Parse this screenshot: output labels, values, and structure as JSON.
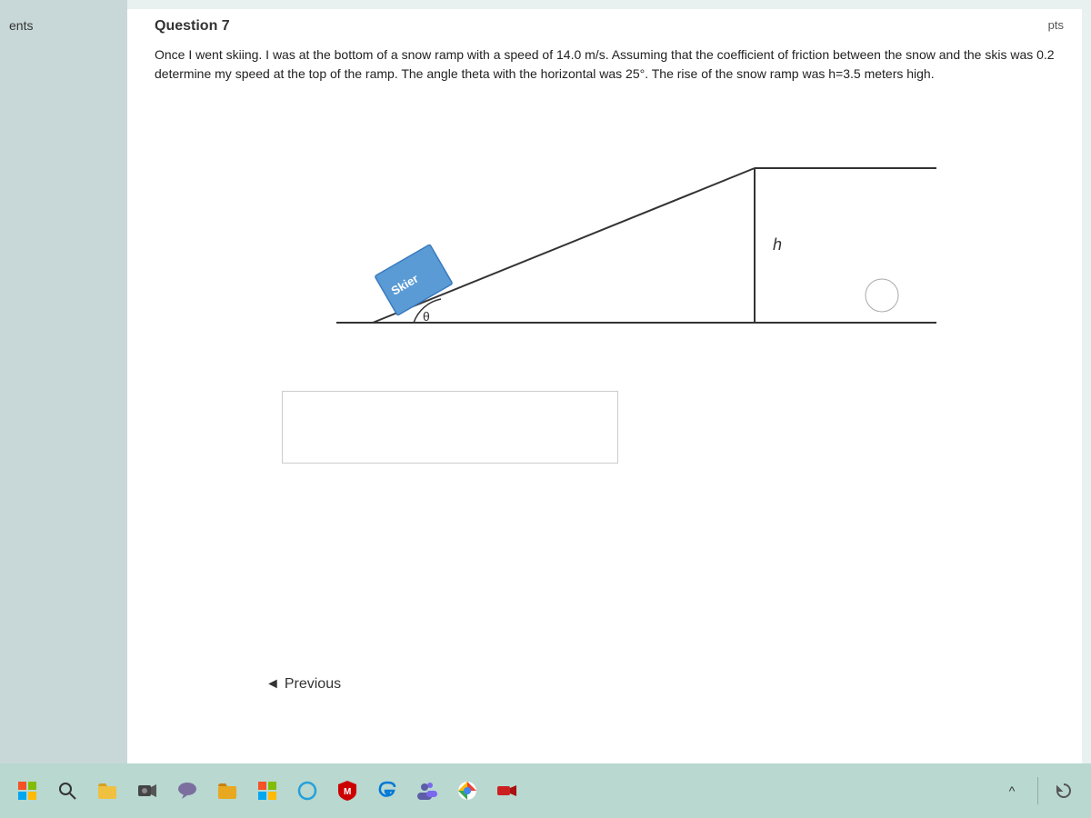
{
  "sidebar": {
    "label": "ents"
  },
  "header": {
    "question_title": "Question 7",
    "pts_label": "pts"
  },
  "question": {
    "text": "Once I went skiing.  I was at the bottom of a snow ramp with a speed of 14.0 m/s. Assuming that the coefficient of friction between the snow and the skis was 0.2  determine my speed at the top of the ramp. The angle theta with the horizontal was 25°. The  rise of the snow ramp was h=3.5 meters high.",
    "diagram": {
      "skier_label": "Skier",
      "height_label": "h",
      "angle_label": "θ"
    }
  },
  "navigation": {
    "previous_label": "Previous"
  },
  "taskbar": {
    "icons": [
      {
        "name": "windows-start",
        "symbol": "⊞"
      },
      {
        "name": "search",
        "symbol": "🔍"
      },
      {
        "name": "file-explorer",
        "symbol": "📁"
      },
      {
        "name": "camera-app",
        "symbol": "📷"
      },
      {
        "name": "chat-app",
        "symbol": "💬"
      },
      {
        "name": "folder",
        "symbol": "📂"
      },
      {
        "name": "microsoft-store",
        "symbol": "🪟"
      },
      {
        "name": "cortana",
        "symbol": "○"
      },
      {
        "name": "mcafee",
        "symbol": "🛡"
      },
      {
        "name": "edge",
        "symbol": "🌐"
      },
      {
        "name": "teams",
        "symbol": "👥"
      },
      {
        "name": "chrome",
        "symbol": "⊙"
      },
      {
        "name": "video",
        "symbol": "📹"
      }
    ]
  }
}
